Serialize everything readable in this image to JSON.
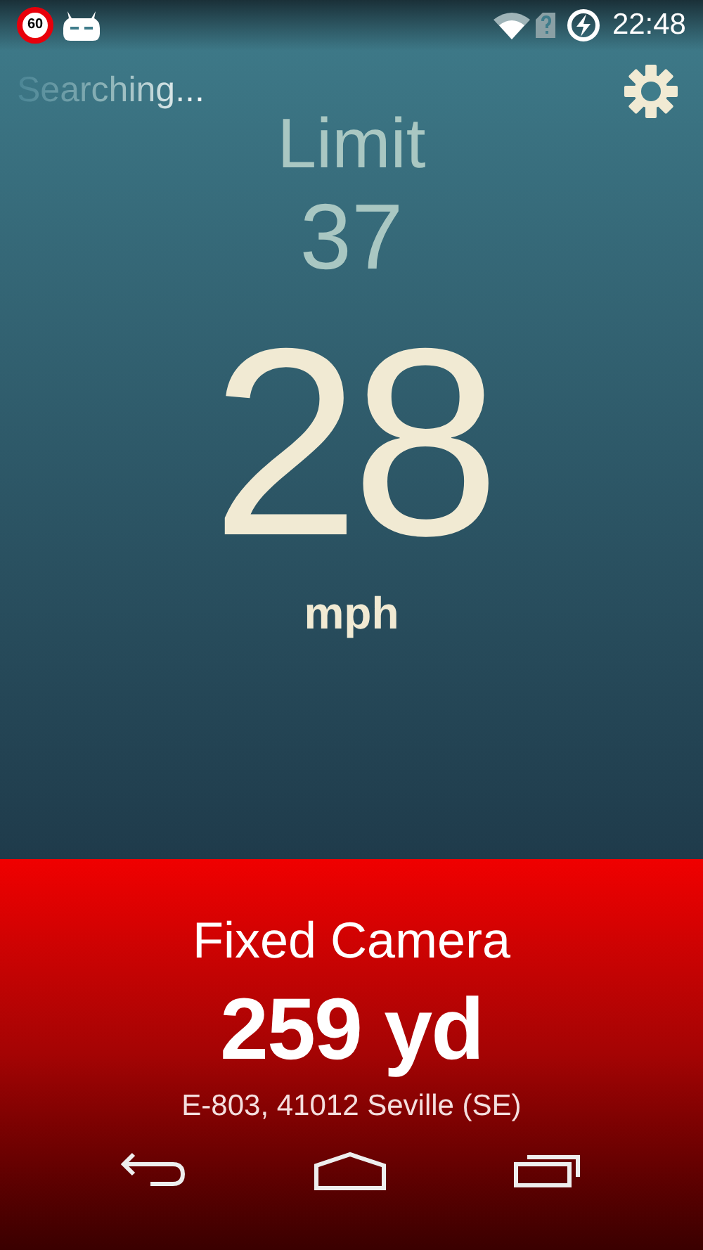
{
  "status_bar": {
    "speed_sign": "60",
    "time": "22:48"
  },
  "status_text": "Searching...",
  "speed_limit": {
    "label": "Limit",
    "value": "37"
  },
  "speed": {
    "value": "28",
    "unit": "mph"
  },
  "alert": {
    "title": "Fixed Camera",
    "distance": "259 yd",
    "address": "E-803, 41012 Seville (SE)"
  }
}
